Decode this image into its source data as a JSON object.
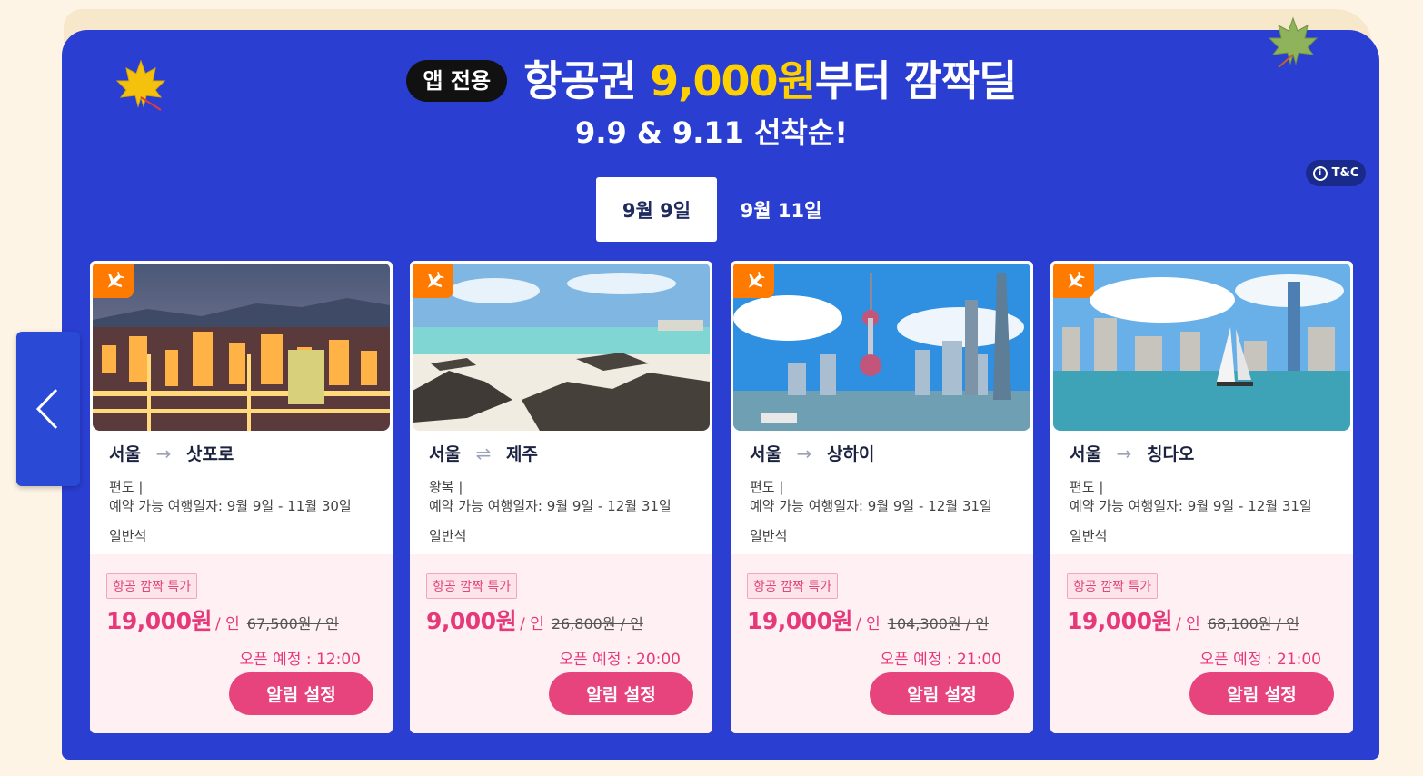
{
  "header": {
    "app_badge": "앱 전용",
    "title_prefix": "항공권 ",
    "title_highlight": "9,000원",
    "title_suffix": "부터 깜짝딜",
    "subtitle": "9.9 & 9.11 선착순!",
    "tc_label": "T&C"
  },
  "tabs": [
    {
      "label": "9월 9일",
      "active": true
    },
    {
      "label": "9월 11일",
      "active": false
    }
  ],
  "colors": {
    "panel": "#2a3ed2",
    "highlight": "#ffd000",
    "accent_pink": "#e6397a",
    "plane_badge": "#ff7a00"
  },
  "cards": [
    {
      "from": "서울",
      "arrow_icon": "one-way-arrow-icon",
      "arrow": "→",
      "to": "삿포로",
      "trip_type": "편도 |",
      "travel_period": "예약 가능 여행일자: 9월 9일 - 11월 30일",
      "seat_class": "일반석",
      "deal_tag": "항공 깜짝 특가",
      "price": "19,000원",
      "per": "/ 인",
      "original_price": "67,500원 / 인",
      "open_time": "오픈 예정 : 12:00",
      "button": "알림 설정",
      "photo_icon": "sapporo-night-city-photo"
    },
    {
      "from": "서울",
      "arrow_icon": "round-trip-arrow-icon",
      "arrow": "⇌",
      "to": "제주",
      "trip_type": "왕복 |",
      "travel_period": "예약 가능 여행일자: 9월 9일 - 12월 31일",
      "seat_class": "일반석",
      "deal_tag": "항공 깜짝 특가",
      "price": "9,000원",
      "per": "/ 인",
      "original_price": "26,800원 / 인",
      "open_time": "오픈 예정 : 20:00",
      "button": "알림 설정",
      "photo_icon": "jeju-beach-rocks-photo"
    },
    {
      "from": "서울",
      "arrow_icon": "one-way-arrow-icon",
      "arrow": "→",
      "to": "상하이",
      "trip_type": "편도 |",
      "travel_period": "예약 가능 여행일자: 9월 9일 - 12월 31일",
      "seat_class": "일반석",
      "deal_tag": "항공 깜짝 특가",
      "price": "19,000원",
      "per": "/ 인",
      "original_price": "104,300원 / 인",
      "open_time": "오픈 예정 : 21:00",
      "button": "알림 설정",
      "photo_icon": "shanghai-skyline-photo"
    },
    {
      "from": "서울",
      "arrow_icon": "one-way-arrow-icon",
      "arrow": "→",
      "to": "칭다오",
      "trip_type": "편도 |",
      "travel_period": "예약 가능 여행일자: 9월 9일 - 12월 31일",
      "seat_class": "일반석",
      "deal_tag": "항공 깜짝 특가",
      "price": "19,000원",
      "per": "/ 인",
      "original_price": "68,100원 / 인",
      "open_time": "오픈 예정 : 21:00",
      "button": "알림 설정",
      "photo_icon": "qingdao-harbor-photo"
    }
  ]
}
